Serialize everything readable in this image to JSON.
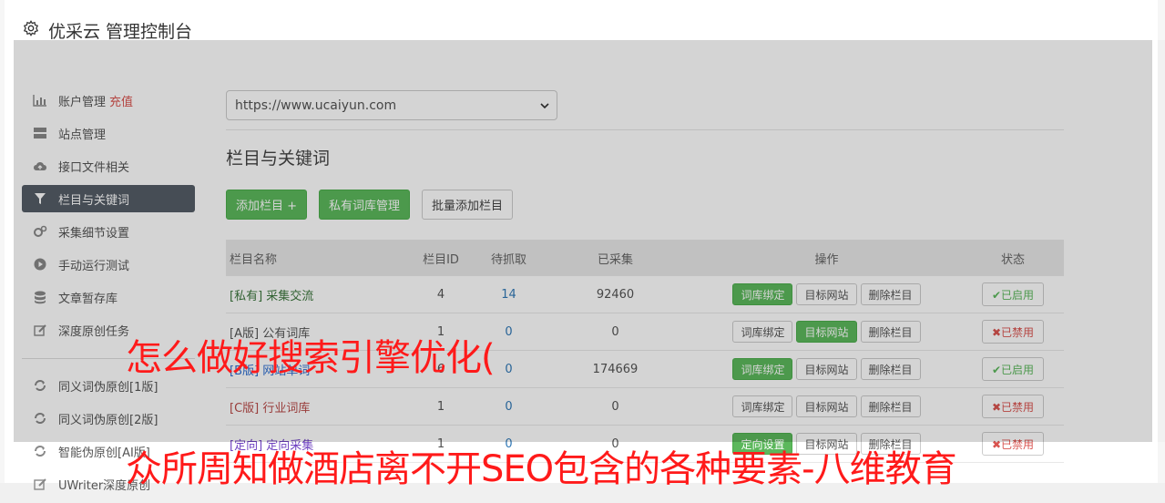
{
  "header": {
    "title": "优采云 管理控制台"
  },
  "sidebar": {
    "items": [
      {
        "icon": "bar-chart-icon",
        "label": "账户管理",
        "badge": "充值"
      },
      {
        "icon": "server-icon",
        "label": "站点管理"
      },
      {
        "icon": "cloud-upload-icon",
        "label": "接口文件相关"
      },
      {
        "icon": "filter-icon",
        "label": "栏目与关键词",
        "active": true
      },
      {
        "icon": "gears-icon",
        "label": "采集细节设置"
      },
      {
        "icon": "play-circle-icon",
        "label": "手动运行测试"
      },
      {
        "icon": "database-icon",
        "label": "文章暂存库"
      },
      {
        "icon": "edit-icon",
        "label": "深度原创任务"
      }
    ],
    "items2": [
      {
        "icon": "refresh-icon",
        "label": "同义词伪原创[1版]"
      },
      {
        "icon": "refresh-icon",
        "label": "同义词伪原创[2版]"
      },
      {
        "icon": "refresh-icon",
        "label": "智能伪原创[AI版]"
      },
      {
        "icon": "edit-icon",
        "label": "UWriter深度原创"
      }
    ]
  },
  "main": {
    "site_select": "https://www.ucaiyun.com",
    "section_title": "栏目与关键词",
    "buttons": {
      "add": "添加栏目 +",
      "private_lib": "私有词库管理",
      "batch_add": "批量添加栏目"
    },
    "table": {
      "headers": [
        "栏目名称",
        "栏目ID",
        "待抓取",
        "已采集",
        "操作",
        "状态"
      ],
      "rows": [
        {
          "tag": "[私有]",
          "name": "采集交流",
          "id": "4",
          "pending": "14",
          "collected": "92460",
          "op1": "词库绑定",
          "op1_green": true,
          "op2": "目标网站",
          "op2_green": false,
          "op3": "删除栏目",
          "status": "✔已启用",
          "on": true
        },
        {
          "tag": "[A版]",
          "name": "公有词库",
          "id": "1",
          "pending": "0",
          "collected": "0",
          "op1": "词库绑定",
          "op1_green": false,
          "op2": "目标网站",
          "op2_green": true,
          "op3": "删除栏目",
          "status": "✖已禁用",
          "on": false
        },
        {
          "tag": "[B版]",
          "name": "网站单词",
          "id": "6",
          "pending": "0",
          "collected": "174669",
          "op1": "词库绑定",
          "op1_green": true,
          "op2": "目标网站",
          "op2_green": false,
          "op3": "删除栏目",
          "status": "✔已启用",
          "on": true
        },
        {
          "tag": "[C版]",
          "name": "行业词库",
          "id": "1",
          "pending": "0",
          "collected": "0",
          "op1": "词库绑定",
          "op1_green": false,
          "op2": "目标网站",
          "op2_green": false,
          "op3": "删除栏目",
          "status": "✖已禁用",
          "on": false
        },
        {
          "tag": "[定向]",
          "name": "定向采集",
          "id": "1",
          "pending": "0",
          "collected": "0",
          "op1": "定向设置",
          "op1_green": true,
          "op2": "目标网站",
          "op2_green": false,
          "op3": "删除栏目",
          "status": "✖已禁用",
          "on": false
        }
      ]
    }
  },
  "overlay_text": {
    "line1": "怎么做好搜索引擎优化(",
    "line2": "众所周知做酒店离不开SEO包含的各种要素-八维教育"
  },
  "colors": {
    "green": "#5cb85c",
    "red": "#d9534f",
    "headline": "#ff1a1a",
    "active_nav": "#555d67"
  }
}
